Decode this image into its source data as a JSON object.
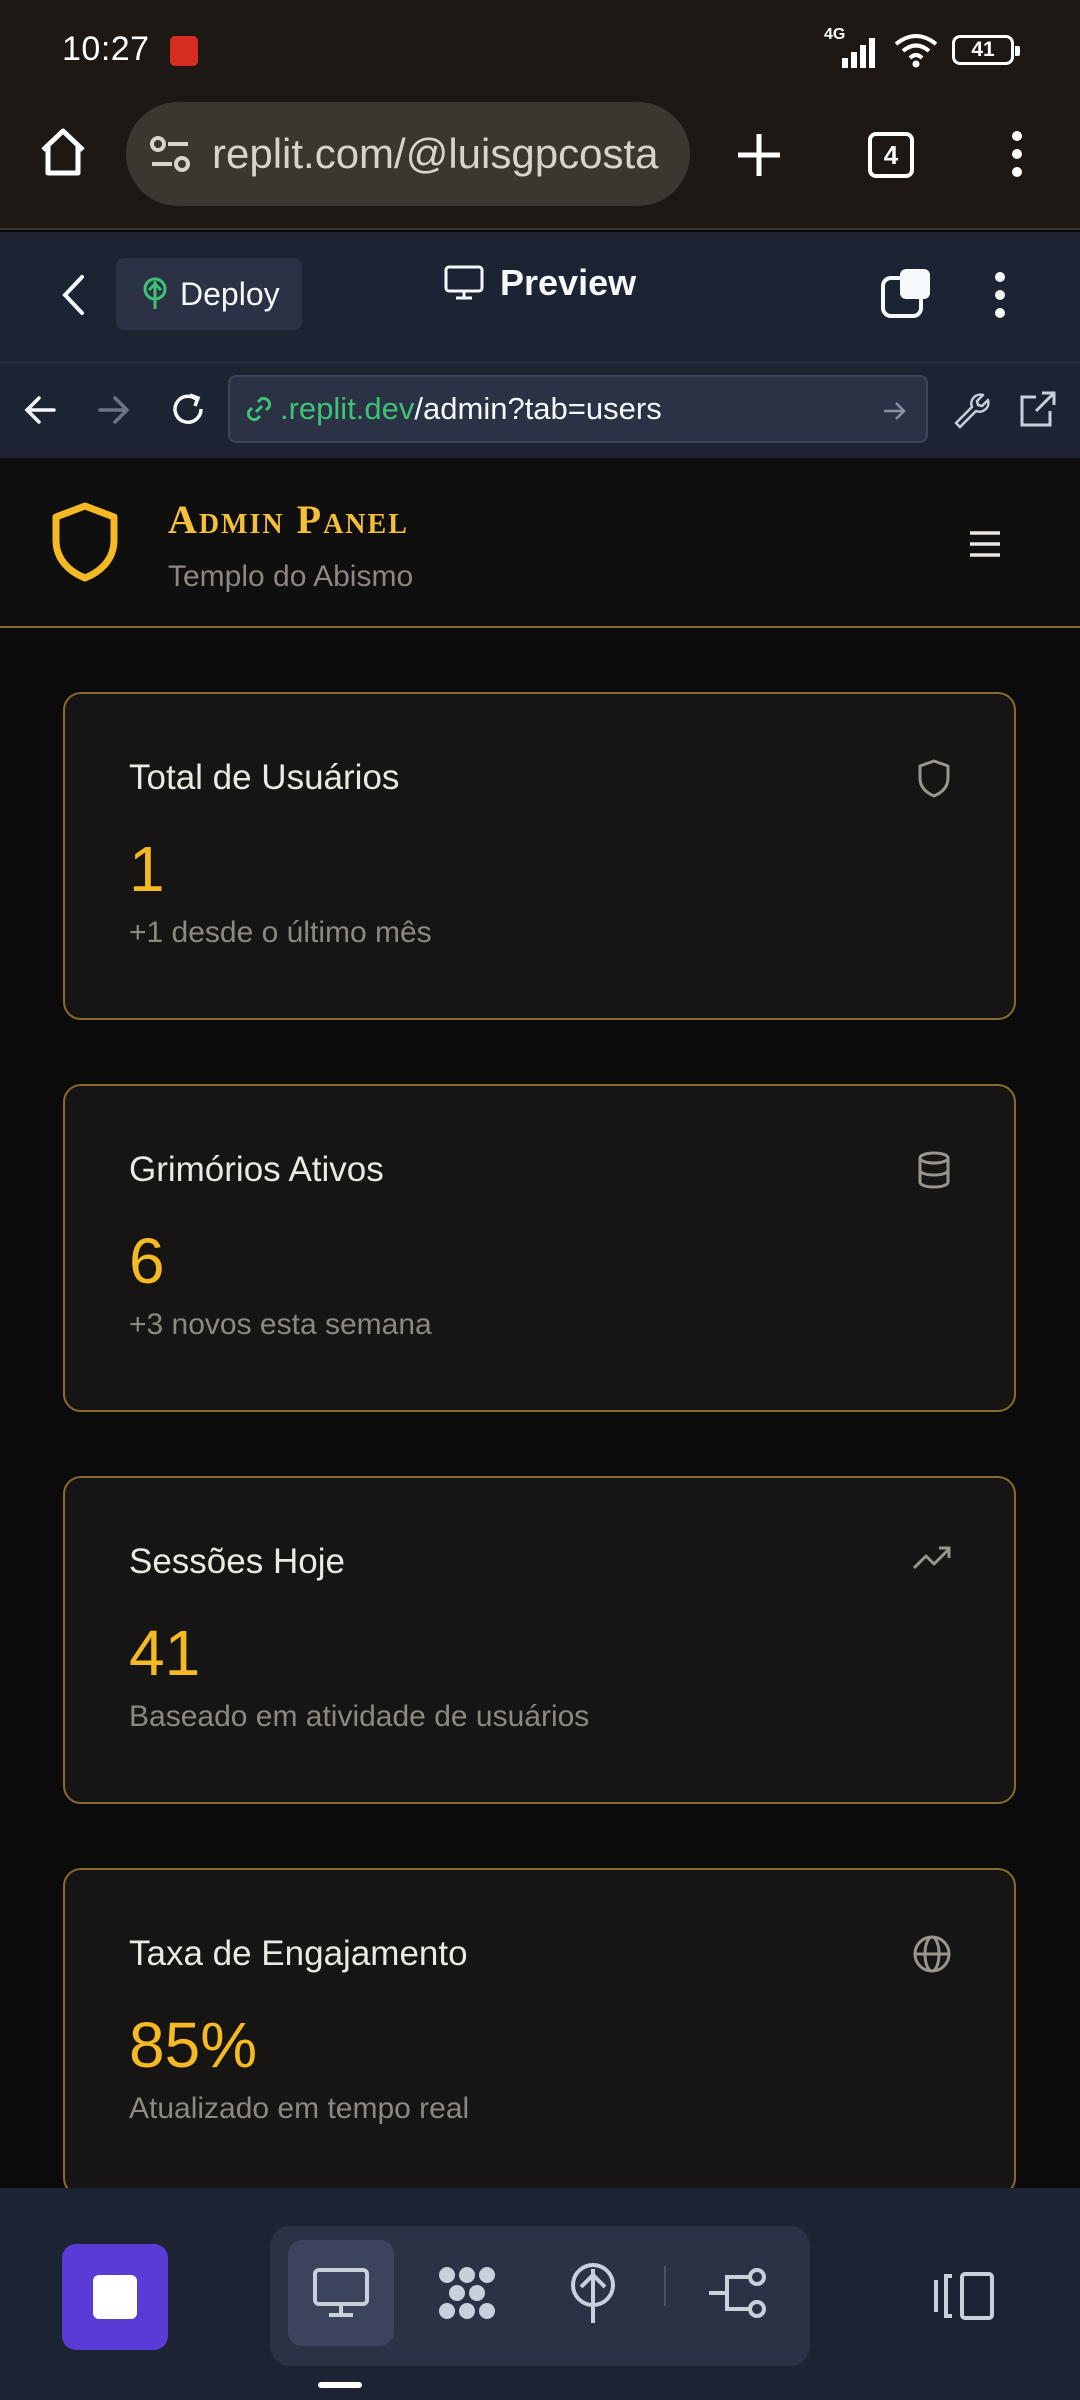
{
  "status_bar": {
    "time": "10:27",
    "network": "4G",
    "battery": "41"
  },
  "browser": {
    "url": "replit.com/@luisgpcosta",
    "tab_count": "4"
  },
  "replit_header": {
    "deploy_label": "Deploy",
    "preview_label": "Preview"
  },
  "address_bar": {
    "url_domain": ".replit.dev",
    "url_path": "/admin?tab=users"
  },
  "app": {
    "title": "Admin Panel",
    "subtitle": "Templo do Abismo"
  },
  "stats": [
    {
      "title": "Total de Usuários",
      "value": "1",
      "subtitle": "+1 desde o último mês",
      "icon": "shield-icon"
    },
    {
      "title": "Grimórios Ativos",
      "value": "6",
      "subtitle": "+3 novos esta semana",
      "icon": "database-icon"
    },
    {
      "title": "Sessões Hoje",
      "value": "41",
      "subtitle": "Baseado em atividade de usuários",
      "icon": "trending-up-icon"
    },
    {
      "title": "Taxa de Engajamento",
      "value": "85%",
      "subtitle": "Atualizado em tempo real",
      "icon": "globe-icon"
    }
  ],
  "colors": {
    "accent_gold": "#f5b924",
    "card_border": "#8a6a2c",
    "replit_bg": "#1c2333",
    "stop_button": "#5b3bd6"
  }
}
